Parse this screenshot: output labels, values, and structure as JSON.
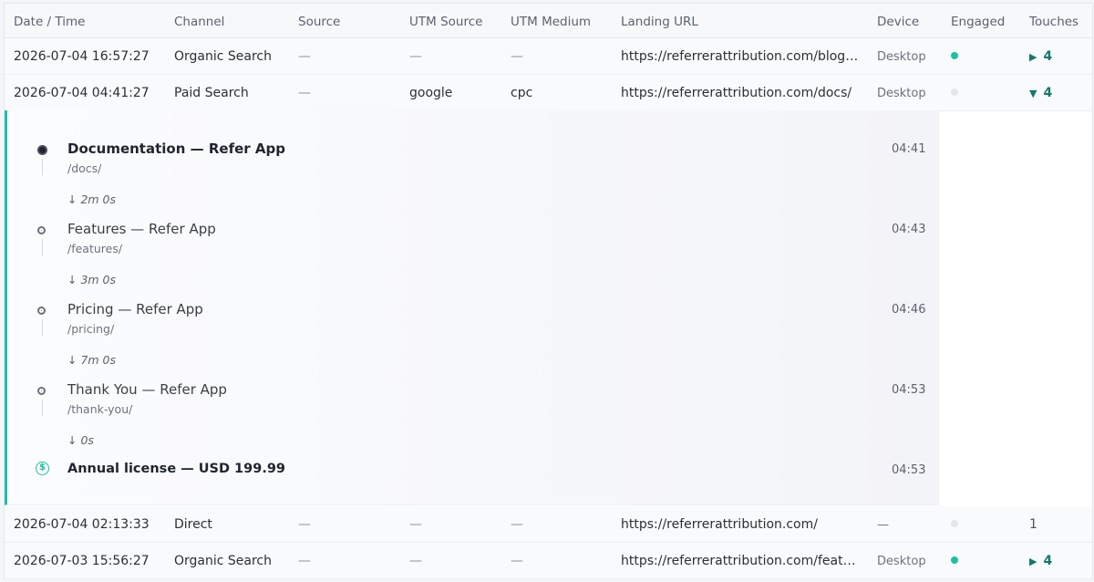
{
  "columns": [
    "Date / Time",
    "Channel",
    "Source",
    "UTM Source",
    "UTM Medium",
    "Landing URL",
    "Device",
    "Engaged",
    "Touches"
  ],
  "rows": [
    {
      "datetime": "2026-07-04 16:57:27",
      "channel": "Organic Search",
      "source": "—",
      "utm_source": "—",
      "utm_medium": "—",
      "landing_url": "https://referrerattribution.com/blog/...",
      "device": "Desktop",
      "engaged": true,
      "touches": "4",
      "toggle": "▶"
    },
    {
      "datetime": "2026-07-04 04:41:27",
      "channel": "Paid Search",
      "source": "—",
      "utm_source": "google",
      "utm_medium": "cpc",
      "landing_url": "https://referrerattribution.com/docs/",
      "device": "Desktop",
      "engaged": false,
      "touches": "4",
      "toggle": "▼"
    },
    {
      "datetime": "2026-07-04 02:13:33",
      "channel": "Direct",
      "source": "—",
      "utm_source": "—",
      "utm_medium": "—",
      "landing_url": "https://referrerattribution.com/",
      "device": "—",
      "engaged": false,
      "touches": "1",
      "toggle": ""
    },
    {
      "datetime": "2026-07-03 15:56:27",
      "channel": "Organic Search",
      "source": "—",
      "utm_source": "—",
      "utm_medium": "—",
      "landing_url": "https://referrerattribution.com/featur...",
      "device": "Desktop",
      "engaged": true,
      "touches": "4",
      "toggle": "▶"
    }
  ],
  "journey": {
    "steps": [
      {
        "title": "Documentation — Refer App",
        "path": "/docs/",
        "time": "04:41",
        "gap": "↓  2m 0s"
      },
      {
        "title": "Features — Refer App",
        "path": "/features/",
        "time": "04:43",
        "gap": "↓  3m 0s"
      },
      {
        "title": "Pricing — Refer App",
        "path": "/pricing/",
        "time": "04:46",
        "gap": "↓  7m 0s"
      },
      {
        "title": "Thank You — Refer App",
        "path": "/thank-you/",
        "time": "04:53",
        "gap": "↓  0s"
      }
    ],
    "conversion": {
      "title": "Annual license — USD 199.99",
      "time": "04:53",
      "icon": "dollar-circle-icon",
      "glyph": "$"
    }
  },
  "colors": {
    "accent": "#1dbfa8",
    "engaged_off": "#e3e5e9",
    "touches": "#127a6b"
  }
}
